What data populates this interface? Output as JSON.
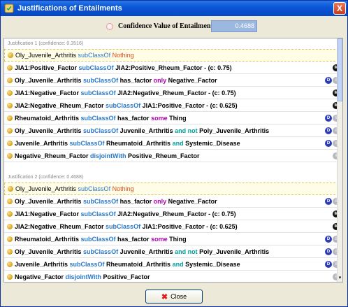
{
  "window": {
    "title": "Justifications of Entailments",
    "close_glyph": "X",
    "icon": "shield-icon"
  },
  "confidence": {
    "label": "Confidence Value of Entailment:",
    "value": "0.4688"
  },
  "justifications": [
    {
      "header": "Justification 1  (confidence: 0.3516)",
      "entailment": [
        {
          "t": "Oly_Juvenile_Arthritis ",
          "c": ""
        },
        {
          "t": "subClassOf",
          "c": "kw-blue"
        },
        {
          "t": " ",
          "c": ""
        },
        {
          "t": "Nothing",
          "c": "kw-red"
        }
      ],
      "axioms": [
        {
          "parts": [
            {
              "t": "JIA1:Positive_Factor ",
              "c": ""
            },
            {
              "t": "subClassOf",
              "c": "kw-blue"
            },
            {
              "t": " JIA2:Positive_Rheum_Factor - (c: 0.75)",
              "c": ""
            }
          ],
          "badges": [
            "m"
          ]
        },
        {
          "parts": [
            {
              "t": "Oly_Juvenile_Arthritis ",
              "c": ""
            },
            {
              "t": "subClassOf",
              "c": "kw-blue"
            },
            {
              "t": " has_factor ",
              "c": ""
            },
            {
              "t": "only",
              "c": "kw-magenta"
            },
            {
              "t": " Negative_Factor",
              "c": ""
            }
          ],
          "badges": [
            "d",
            "i"
          ]
        },
        {
          "parts": [
            {
              "t": "JIA1:Negative_Factor ",
              "c": ""
            },
            {
              "t": "subClassOf",
              "c": "kw-blue"
            },
            {
              "t": " JIA2:Negative_Rheum_Factor - (c: 0.75)",
              "c": ""
            }
          ],
          "badges": [
            "m"
          ]
        },
        {
          "parts": [
            {
              "t": "JIA2:Negative_Rheum_Factor ",
              "c": ""
            },
            {
              "t": "subClassOf",
              "c": "kw-blue"
            },
            {
              "t": " JIA1:Positive_Factor - (c: 0.625)",
              "c": ""
            }
          ],
          "badges": [
            "m"
          ]
        },
        {
          "parts": [
            {
              "t": "Rheumatoid_Arthritis ",
              "c": ""
            },
            {
              "t": "subClassOf",
              "c": "kw-blue"
            },
            {
              "t": " has_factor ",
              "c": ""
            },
            {
              "t": "some",
              "c": "kw-magenta"
            },
            {
              "t": " Thing",
              "c": ""
            }
          ],
          "badges": [
            "d",
            "i"
          ]
        },
        {
          "parts": [
            {
              "t": "Oly_Juvenile_Arthritis ",
              "c": ""
            },
            {
              "t": "subClassOf",
              "c": "kw-blue"
            },
            {
              "t": " Juvenile_Arthritis ",
              "c": ""
            },
            {
              "t": "and not",
              "c": "kw-teal"
            },
            {
              "t": " Poly_Juvenile_Arthritis",
              "c": ""
            }
          ],
          "badges": [
            "d",
            "i"
          ]
        },
        {
          "parts": [
            {
              "t": "Juvenile_Arthritis ",
              "c": ""
            },
            {
              "t": "subClassOf",
              "c": "kw-blue"
            },
            {
              "t": " Rheumatoid_Arthritis ",
              "c": ""
            },
            {
              "t": "and",
              "c": "kw-teal"
            },
            {
              "t": " Systemic_Disease",
              "c": ""
            }
          ],
          "badges": [
            "d",
            "i"
          ]
        },
        {
          "parts": [
            {
              "t": "Negative_Rheum_Factor ",
              "c": ""
            },
            {
              "t": "disjointWith",
              "c": "kw-blue"
            },
            {
              "t": " Positive_Rheum_Factor",
              "c": ""
            }
          ],
          "badges": [
            "i"
          ]
        }
      ]
    },
    {
      "header": "Justification 2  (confidence: 0.4688)",
      "entailment": [
        {
          "t": "Oly_Juvenile_Arthritis ",
          "c": ""
        },
        {
          "t": "subClassOf",
          "c": "kw-blue"
        },
        {
          "t": " ",
          "c": ""
        },
        {
          "t": "Nothing",
          "c": "kw-red"
        }
      ],
      "axioms": [
        {
          "parts": [
            {
              "t": "Oly_Juvenile_Arthritis ",
              "c": ""
            },
            {
              "t": "subClassOf",
              "c": "kw-blue"
            },
            {
              "t": " has_factor ",
              "c": ""
            },
            {
              "t": "only",
              "c": "kw-magenta"
            },
            {
              "t": " Negative_Factor",
              "c": ""
            }
          ],
          "badges": [
            "d",
            "i"
          ]
        },
        {
          "parts": [
            {
              "t": "JIA1:Negative_Factor ",
              "c": ""
            },
            {
              "t": "subClassOf",
              "c": "kw-blue"
            },
            {
              "t": " JIA2:Negative_Rheum_Factor - (c: 0.75)",
              "c": ""
            }
          ],
          "badges": [
            "m"
          ]
        },
        {
          "parts": [
            {
              "t": "JIA2:Negative_Rheum_Factor ",
              "c": ""
            },
            {
              "t": "subClassOf",
              "c": "kw-blue"
            },
            {
              "t": " JIA1:Positive_Factor - (c: 0.625)",
              "c": ""
            }
          ],
          "badges": [
            "m"
          ]
        },
        {
          "parts": [
            {
              "t": "Rheumatoid_Arthritis ",
              "c": ""
            },
            {
              "t": "subClassOf",
              "c": "kw-blue"
            },
            {
              "t": " has_factor ",
              "c": ""
            },
            {
              "t": "some",
              "c": "kw-magenta"
            },
            {
              "t": " Thing",
              "c": ""
            }
          ],
          "badges": [
            "d",
            "i"
          ]
        },
        {
          "parts": [
            {
              "t": "Oly_Juvenile_Arthritis ",
              "c": ""
            },
            {
              "t": "subClassOf",
              "c": "kw-blue"
            },
            {
              "t": " Juvenile_Arthritis ",
              "c": ""
            },
            {
              "t": "and not",
              "c": "kw-teal"
            },
            {
              "t": " Poly_Juvenile_Arthritis",
              "c": ""
            }
          ],
          "badges": [
            "d",
            "i"
          ]
        },
        {
          "parts": [
            {
              "t": "Juvenile_Arthritis ",
              "c": ""
            },
            {
              "t": "subClassOf",
              "c": "kw-blue"
            },
            {
              "t": " Rheumatoid_Arthritis ",
              "c": ""
            },
            {
              "t": "and",
              "c": "kw-teal"
            },
            {
              "t": " Systemic_Disease",
              "c": ""
            }
          ],
          "badges": [
            "d",
            "i"
          ]
        },
        {
          "parts": [
            {
              "t": "Negative_Factor ",
              "c": ""
            },
            {
              "t": "disjointWith",
              "c": "kw-blue"
            },
            {
              "t": " Positive_Factor",
              "c": ""
            }
          ],
          "badges": [
            "i"
          ]
        }
      ]
    }
  ],
  "badge_glyphs": {
    "m": "M",
    "d": "D",
    "i": "i"
  },
  "close_button": {
    "label": "Close",
    "icon": "close-icon",
    "glyph": "✖"
  },
  "scrollbar": {
    "up_glyph": "▴",
    "down_glyph": "▾"
  }
}
